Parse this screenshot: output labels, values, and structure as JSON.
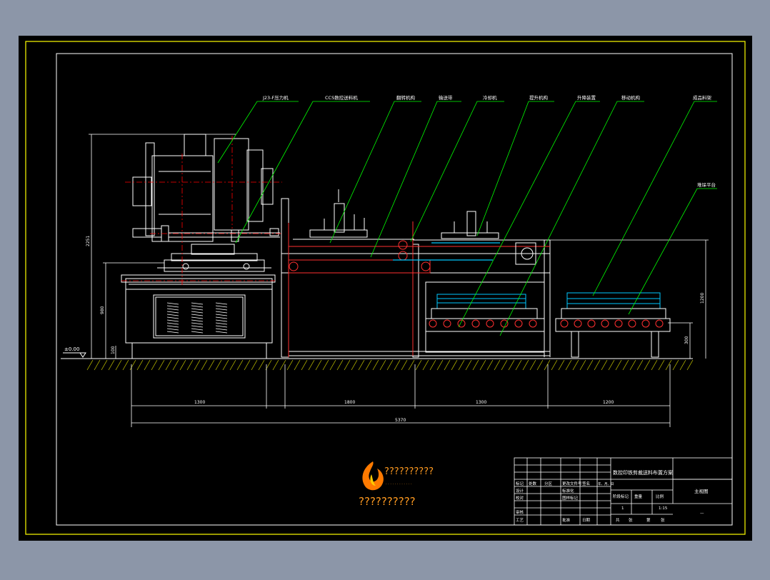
{
  "callouts": [
    "J23-F压力机",
    "CCS数控送料机",
    "翻转机构",
    "输送带",
    "冷却机",
    "提升机构",
    "升降装置",
    "移动机构",
    "成品料架",
    "堆垛平台"
  ],
  "dimensions": {
    "height_total": "2251",
    "height_table": "980",
    "height_base": "100",
    "level_mark": "±0.00",
    "height_right": "1200",
    "height_right_small": "300",
    "span_1": "1300",
    "span_2": "1800",
    "span_3": "1300",
    "span_4": "1200",
    "total_length": "5370"
  },
  "watermark": {
    "brand": "??????????",
    "subtitle": ". . . . . . . . . . . .",
    "tagline": "??????????"
  },
  "title_block": {
    "drawing_title": "数控印铁剪裁送料布置方案",
    "view_name": "主视图",
    "scale": "1:15",
    "sheet": "1",
    "dash": "—",
    "headers": [
      "标记",
      "处数",
      "分区",
      "更改文件号",
      "签名",
      "年、月、日"
    ],
    "roles": [
      "设计",
      "标准化",
      "校对",
      "审核",
      "工艺",
      "批准"
    ],
    "stage_headers": [
      "阶段标记",
      "重量",
      "比例"
    ],
    "footer": [
      "共",
      "张",
      "第",
      "张"
    ],
    "misc": [
      "图样标记",
      "日期"
    ]
  },
  "colors": {
    "background": "#000000",
    "border": "#ffff00",
    "geometry": "#ffffff",
    "callout": "#00ff00",
    "centerline": "#ff0000",
    "conveyor": "#00c8ff",
    "watermark": "#ff7a00"
  }
}
